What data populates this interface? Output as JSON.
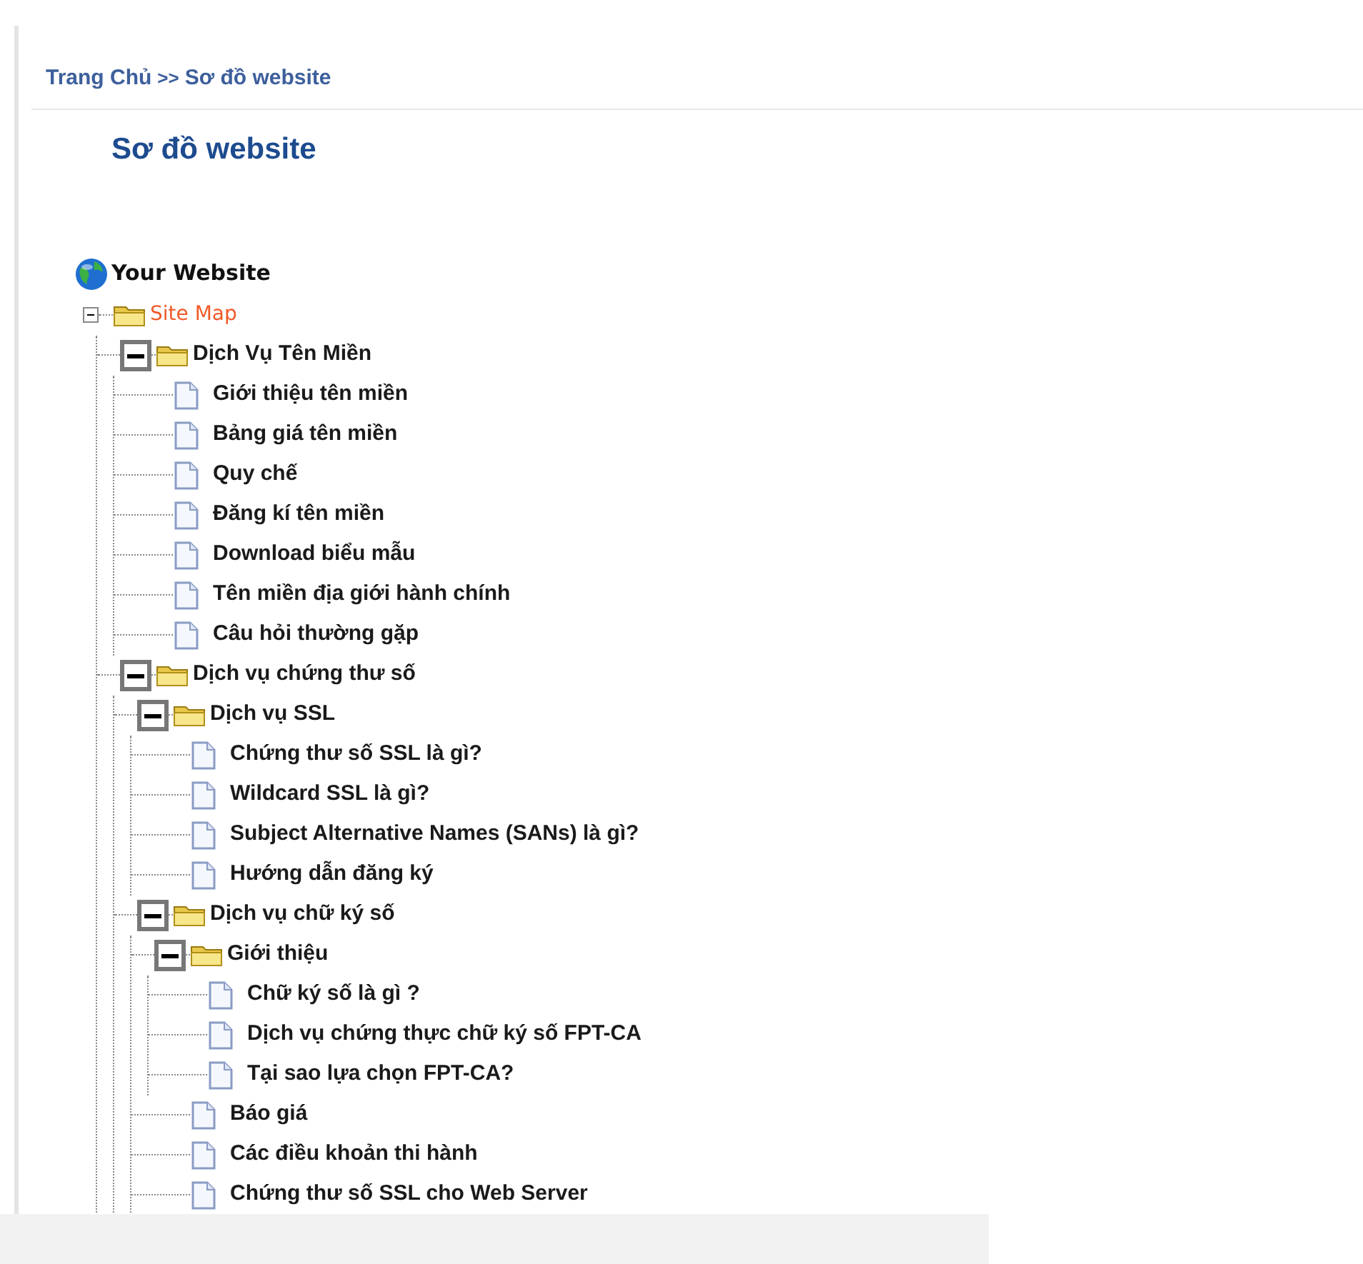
{
  "breadcrumb": [
    {
      "label": "Trang Chủ",
      "kind": "link"
    },
    {
      "label": ">>",
      "kind": "separator"
    },
    {
      "label": "Sơ đồ website",
      "kind": "link"
    }
  ],
  "page_title": "Sơ đồ website",
  "tree": {
    "label": "Your Website",
    "kind": "site",
    "children": [
      {
        "label": "Site Map",
        "kind": "folder",
        "expanded": true,
        "children": [
          {
            "label": "Dịch Vụ Tên Miền",
            "kind": "folder",
            "expanded": true,
            "children": [
              {
                "label": "Giới thiệu tên miền",
                "kind": "page"
              },
              {
                "label": "Bảng giá tên miền",
                "kind": "page"
              },
              {
                "label": "Quy chế",
                "kind": "page"
              },
              {
                "label": "Đăng kí tên miền",
                "kind": "page"
              },
              {
                "label": "Download biểu mẫu",
                "kind": "page"
              },
              {
                "label": "Tên miền địa giới hành chính",
                "kind": "page"
              },
              {
                "label": "Câu hỏi thường gặp",
                "kind": "page"
              }
            ]
          },
          {
            "label": "Dịch vụ chứng thư số",
            "kind": "folder",
            "expanded": true,
            "children": [
              {
                "label": "Dịch vụ SSL",
                "kind": "folder",
                "expanded": true,
                "children": [
                  {
                    "label": "Chứng thư số SSL là gì?",
                    "kind": "page"
                  },
                  {
                    "label": "Wildcard SSL là gì?",
                    "kind": "page"
                  },
                  {
                    "label": "Subject Alternative Names (SANs) là gì?",
                    "kind": "page"
                  },
                  {
                    "label": "Hướng dẫn đăng ký",
                    "kind": "page"
                  }
                ]
              },
              {
                "label": "Dịch vụ chữ ký số",
                "kind": "folder",
                "expanded": true,
                "children": [
                  {
                    "label": "Giới thiệu",
                    "kind": "folder",
                    "expanded": true,
                    "children": [
                      {
                        "label": "Chữ ký số là gì ?",
                        "kind": "page"
                      },
                      {
                        "label": "Dịch vụ chứng thực chữ ký số FPT-CA",
                        "kind": "page"
                      },
                      {
                        "label": "Tại sao lựa chọn FPT-CA?",
                        "kind": "page"
                      }
                    ]
                  },
                  {
                    "label": "Báo giá",
                    "kind": "page"
                  },
                  {
                    "label": "Các điều khoản thi hành",
                    "kind": "page"
                  },
                  {
                    "label": "Chứng thư số SSL cho Web Server",
                    "kind": "page"
                  }
                ]
              }
            ]
          }
        ]
      }
    ]
  }
}
